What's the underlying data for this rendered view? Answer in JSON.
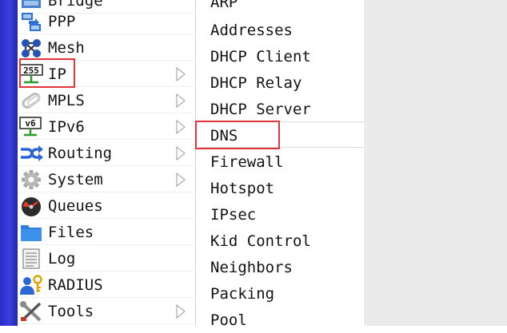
{
  "main_menu": {
    "items": [
      {
        "label": "Bridge",
        "icon": "bridge-icon",
        "has_submenu": false
      },
      {
        "label": "PPP",
        "icon": "ppp-icon",
        "has_submenu": false
      },
      {
        "label": "Mesh",
        "icon": "mesh-icon",
        "has_submenu": false
      },
      {
        "label": "IP",
        "icon": "ip-icon",
        "has_submenu": true
      },
      {
        "label": "MPLS",
        "icon": "mpls-icon",
        "has_submenu": true
      },
      {
        "label": "IPv6",
        "icon": "ipv6-icon",
        "has_submenu": true
      },
      {
        "label": "Routing",
        "icon": "routing-icon",
        "has_submenu": true
      },
      {
        "label": "System",
        "icon": "gear-icon",
        "has_submenu": true
      },
      {
        "label": "Queues",
        "icon": "gauge-icon",
        "has_submenu": false
      },
      {
        "label": "Files",
        "icon": "folder-icon",
        "has_submenu": false
      },
      {
        "label": "Log",
        "icon": "log-icon",
        "has_submenu": false
      },
      {
        "label": "RADIUS",
        "icon": "radius-icon",
        "has_submenu": false
      },
      {
        "label": "Tools",
        "icon": "tools-icon",
        "has_submenu": true
      }
    ],
    "ip_icon_text": "255"
  },
  "ip_submenu": {
    "items": [
      {
        "label": "ARP"
      },
      {
        "label": "Addresses"
      },
      {
        "label": "DHCP Client"
      },
      {
        "label": "DHCP Relay"
      },
      {
        "label": "DHCP Server"
      },
      {
        "label": "DNS"
      },
      {
        "label": "Firewall"
      },
      {
        "label": "Hotspot"
      },
      {
        "label": "IPsec"
      },
      {
        "label": "Kid Control"
      },
      {
        "label": "Neighbors"
      },
      {
        "label": "Packing"
      },
      {
        "label": "Pool"
      }
    ]
  },
  "colors": {
    "highlight_border": "#e2343b",
    "sidebar_strip": "#2a2cc4",
    "right_panel": "#eaeaea"
  }
}
